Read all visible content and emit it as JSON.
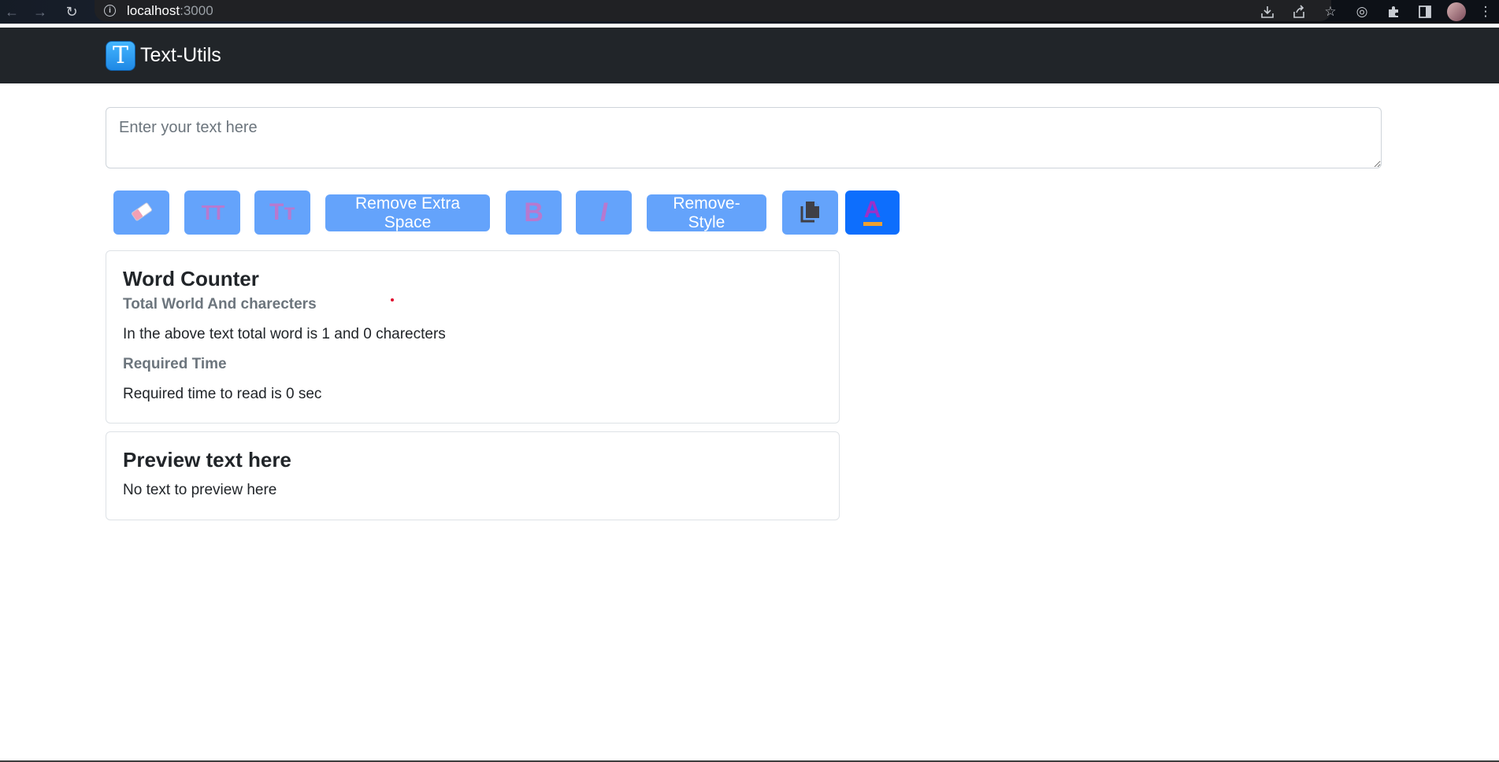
{
  "browser": {
    "url_host": "localhost",
    "url_port": ":3000",
    "icons": [
      "back-icon",
      "forward-icon",
      "reload-icon",
      "info-icon",
      "install-icon",
      "share-icon",
      "bookmark-star-icon",
      "media-icon",
      "extensions-icon",
      "side-panel-icon",
      "profile-avatar",
      "menu-icon"
    ]
  },
  "navbar": {
    "brand_letter": "T",
    "brand_name": "Text-Utils"
  },
  "editor": {
    "placeholder": "Enter your text here",
    "value": ""
  },
  "toolbar": {
    "buttons": [
      {
        "name": "clear-text-button",
        "icon": "eraser-icon"
      },
      {
        "name": "uppercase-button",
        "icon": "uppercase-icon",
        "glyph": "TT"
      },
      {
        "name": "capitalize-button",
        "icon": "capitalize-icon",
        "glyph": "Tт"
      },
      {
        "name": "remove-extra-space-button",
        "label": "Remove Extra Space"
      },
      {
        "name": "bold-button",
        "icon": "bold-icon",
        "glyph": "B"
      },
      {
        "name": "italic-button",
        "icon": "italic-icon",
        "glyph": "I"
      },
      {
        "name": "remove-style-button",
        "label": "Remove-Style"
      },
      {
        "name": "copy-button",
        "icon": "copy-icon"
      },
      {
        "name": "text-color-button",
        "icon": "text-color-icon",
        "glyph": "A"
      }
    ],
    "colors": {
      "button_bg": "#64a3fb",
      "active_bg": "#0d6efd",
      "glyph": "#b779cf"
    }
  },
  "word_counter": {
    "title": "Word Counter",
    "subtitle": "Total World And charecters",
    "summary": "In the above text total word is 1 and 0 charecters",
    "time_subtitle": "Required Time",
    "time_text": "Required time to read is 0 sec"
  },
  "preview": {
    "title": "Preview text here",
    "text": "No text to preview here"
  }
}
